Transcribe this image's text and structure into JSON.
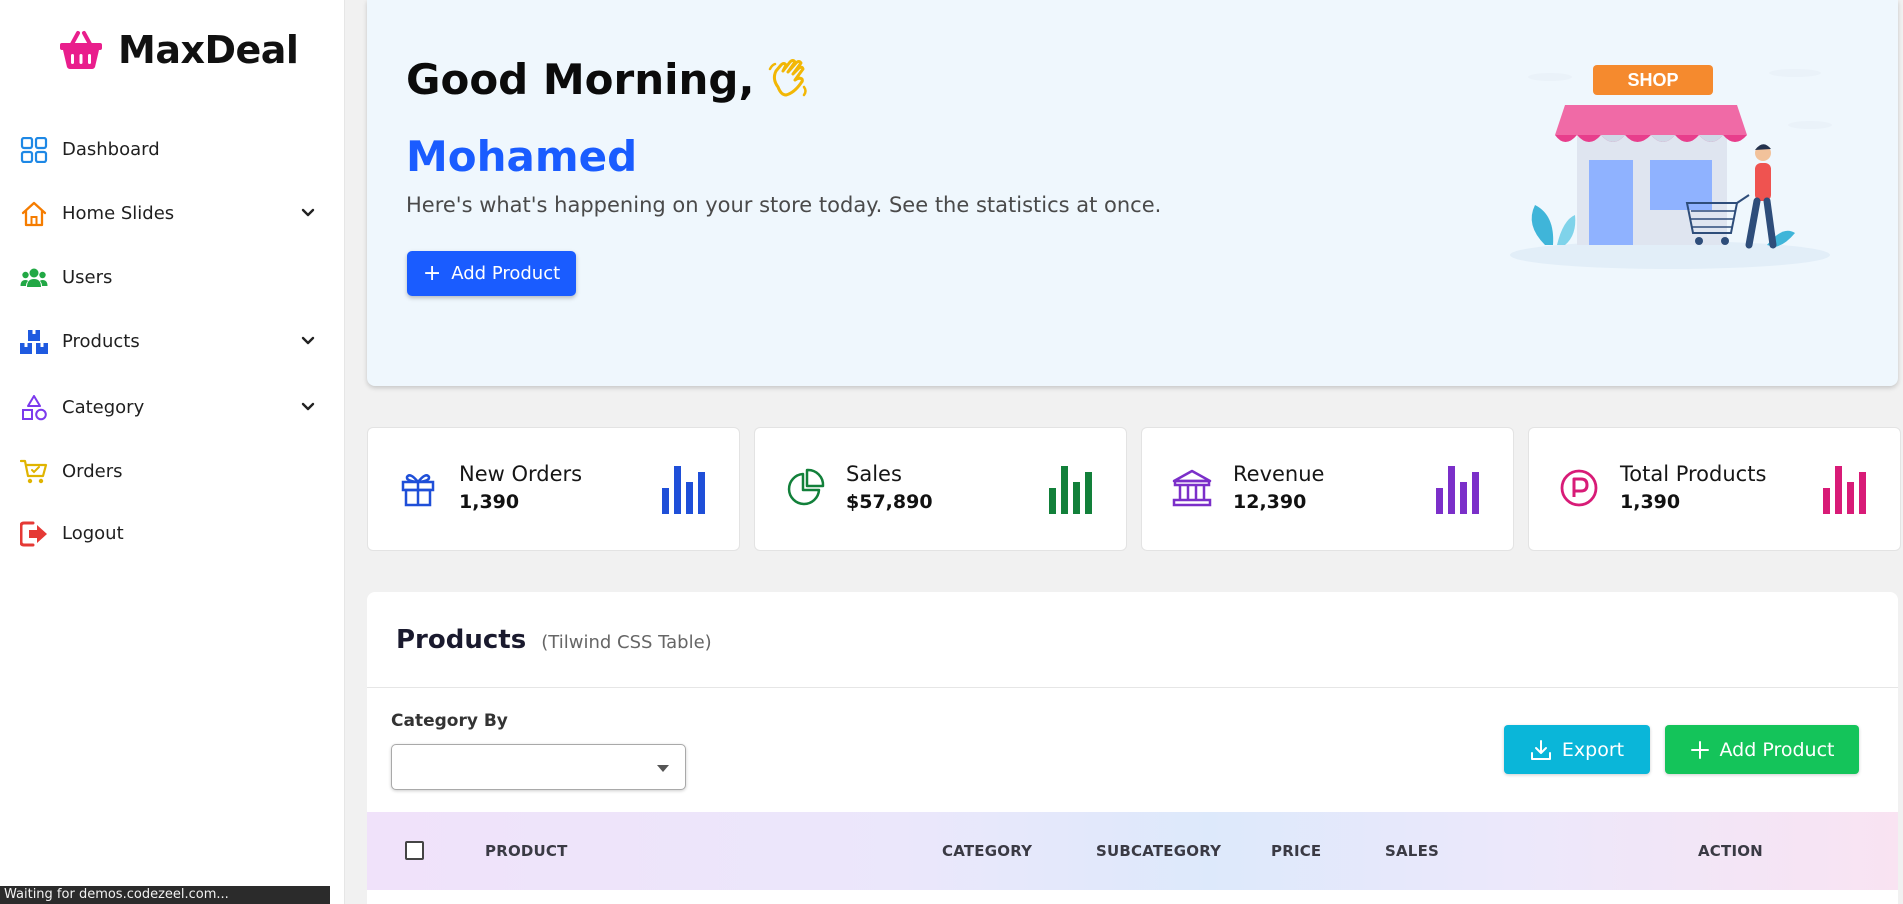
{
  "brand": {
    "name": "MaxDeal",
    "logo_icon": "basket-icon",
    "accent": "#e91e8c"
  },
  "sidebar": {
    "items": [
      {
        "label": "Dashboard",
        "icon": "grid-icon",
        "color": "#1e88e5",
        "has_children": false
      },
      {
        "label": "Home Slides",
        "icon": "home-icon",
        "color": "#f57c00",
        "has_children": true
      },
      {
        "label": "Users",
        "icon": "users-icon",
        "color": "#22a845",
        "has_children": false
      },
      {
        "label": "Products",
        "icon": "boxes-icon",
        "color": "#1f5ae0",
        "has_children": true
      },
      {
        "label": "Category",
        "icon": "shapes-icon",
        "color": "#7c3aed",
        "has_children": true
      },
      {
        "label": "Orders",
        "icon": "cart-icon",
        "color": "#e0b400",
        "has_children": false
      },
      {
        "label": "Logout",
        "icon": "logout-icon",
        "color": "#e53935",
        "has_children": false
      }
    ]
  },
  "hero": {
    "greeting": "Good Morning,",
    "name": "Mohamed",
    "subtitle": "Here's what's happening on your store today. See the statistics at once.",
    "button_label": "Add Product",
    "illustration_sign": "SHOP",
    "background": "#eff7fd",
    "name_color": "#1a5cff"
  },
  "stats": [
    {
      "label": "New Orders",
      "value": "1,390",
      "icon": "gift-icon",
      "color": "#1f4fd8"
    },
    {
      "label": "Sales",
      "value": "$57,890",
      "icon": "pie-icon",
      "color": "#12803a"
    },
    {
      "label": "Revenue",
      "value": "12,390",
      "icon": "bank-icon",
      "color": "#7b2fc9"
    },
    {
      "label": "Total Products",
      "value": "1,390",
      "icon": "p-circle-icon",
      "color": "#d81b77"
    }
  ],
  "products_panel": {
    "title": "Products",
    "subtitle": "(Tilwind CSS Table)",
    "filter_label": "Category By",
    "filter_value": "",
    "export_label": "Export",
    "add_label": "Add Product",
    "columns": [
      "PRODUCT",
      "CATEGORY",
      "SUBCATEGORY",
      "PRICE",
      "SALES",
      "ACTION"
    ]
  },
  "status_bar": {
    "text": "Waiting for demos.codezeel.com..."
  }
}
